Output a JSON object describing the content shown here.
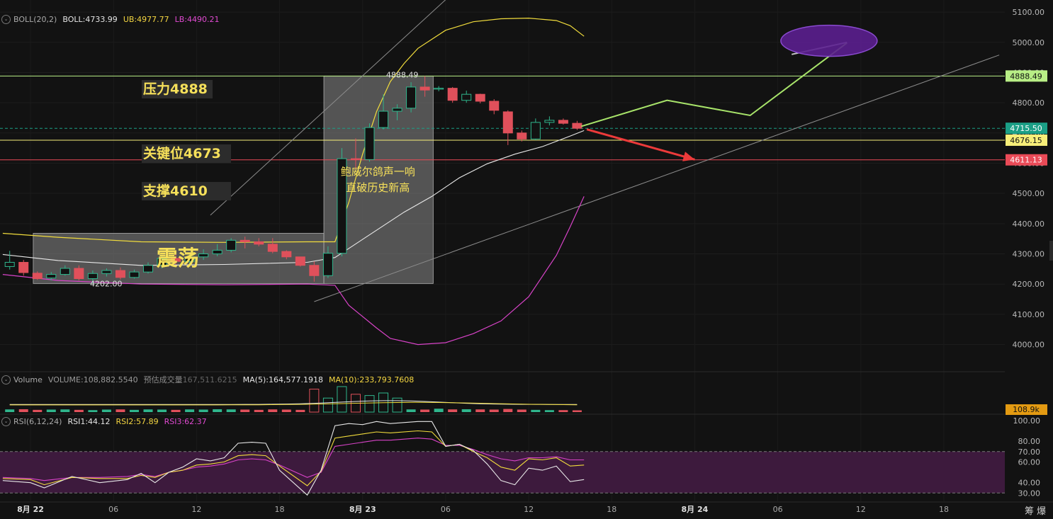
{
  "boll_header": {
    "indicator": "BOLL(20,2)",
    "boll": "BOLL:4733.99",
    "ub": "UB:4977.77",
    "lb": "LB:4490.21"
  },
  "vol_header": {
    "indicator": "Volume",
    "volume": "VOLUME:108,882.5540",
    "est_label": "预估成交量",
    "est_value": "167,511.6215",
    "ma5": "MA(5):164,577.1918",
    "ma10": "MA(10):233,793.7608"
  },
  "rsi_header": {
    "indicator": "RSI(6,12,24)",
    "rsi1": "RSI1:44.12",
    "rsi2": "RSI2:57.89",
    "rsi3": "RSI3:62.37"
  },
  "annotations": {
    "pressure": "压力4888",
    "key_level": "关键位4673",
    "support": "支撑4610",
    "range": "震荡",
    "note_line1": "鲍威尔鸽声一响",
    "note_line2": "直破历史新高",
    "high_label": "4888.49",
    "low_label": "4202.00"
  },
  "corner": "筹 爆",
  "chart_data": [
    {
      "type": "candlestick",
      "title": "",
      "ylim": [
        3910,
        5140
      ],
      "yticks": [
        4000,
        4100,
        4200,
        4300,
        4400,
        4500,
        4600,
        4700,
        4800,
        4900,
        5000,
        5100
      ],
      "ytick_labels": [
        "4000.00",
        "4100.00",
        "4200.00",
        "4300.00",
        "4400.00",
        "4500.00",
        "4600.00",
        "4700.00",
        "4800.00",
        "4900.00",
        "5000.00",
        "5100.00"
      ],
      "xticks": [
        "8月 22",
        "06",
        "12",
        "18",
        "8月 23",
        "06",
        "12",
        "18",
        "8月 24",
        "06",
        "12",
        "18"
      ],
      "xtick_hours": [
        0,
        6,
        12,
        18,
        24,
        30,
        36,
        42,
        48,
        54,
        60,
        66
      ],
      "price_tags": [
        {
          "value": 4888.49,
          "label": "4888.49",
          "color": "#b8ee86",
          "text_color": "#111111"
        },
        {
          "value": 4715.5,
          "label": "4715.50",
          "color": "#1b9f86",
          "text_color": "#ffffff"
        },
        {
          "value": 4676.15,
          "label": "4676.15",
          "color": "#f7ee79",
          "text_color": "#111111"
        },
        {
          "value": 4611.13,
          "label": "4611.13",
          "color": "#ea4a57",
          "text_color": "#ffffff"
        }
      ],
      "horizontal_levels": [
        {
          "value": 4888.49,
          "color": "#b8ee86"
        },
        {
          "value": 4676.15,
          "color": "#f7ee79"
        },
        {
          "value": 4611.13,
          "color": "#ea4a57"
        }
      ],
      "candles": [
        {
          "t": -1.5,
          "o": 4258,
          "h": 4310,
          "l": 4248,
          "c": 4272
        },
        {
          "t": -0.5,
          "o": 4272,
          "h": 4280,
          "l": 4228,
          "c": 4238
        },
        {
          "t": 0.5,
          "o": 4236,
          "h": 4242,
          "l": 4214,
          "c": 4218
        },
        {
          "t": 1.5,
          "o": 4220,
          "h": 4240,
          "l": 4212,
          "c": 4232
        },
        {
          "t": 2.5,
          "o": 4232,
          "h": 4262,
          "l": 4228,
          "c": 4252
        },
        {
          "t": 3.5,
          "o": 4252,
          "h": 4262,
          "l": 4212,
          "c": 4218
        },
        {
          "t": 4.5,
          "o": 4218,
          "h": 4245,
          "l": 4202,
          "c": 4235
        },
        {
          "t": 5.5,
          "o": 4235,
          "h": 4252,
          "l": 4225,
          "c": 4245
        },
        {
          "t": 6.5,
          "o": 4245,
          "h": 4255,
          "l": 4215,
          "c": 4222
        },
        {
          "t": 7.5,
          "o": 4222,
          "h": 4248,
          "l": 4218,
          "c": 4240
        },
        {
          "t": 8.5,
          "o": 4240,
          "h": 4272,
          "l": 4235,
          "c": 4262
        },
        {
          "t": 9.5,
          "o": 4262,
          "h": 4295,
          "l": 4252,
          "c": 4285
        },
        {
          "t": 10.5,
          "o": 4285,
          "h": 4300,
          "l": 4265,
          "c": 4275
        },
        {
          "t": 11.5,
          "o": 4275,
          "h": 4298,
          "l": 4262,
          "c": 4290
        },
        {
          "t": 12.5,
          "o": 4290,
          "h": 4315,
          "l": 4280,
          "c": 4300
        },
        {
          "t": 13.5,
          "o": 4300,
          "h": 4332,
          "l": 4292,
          "c": 4312
        },
        {
          "t": 14.5,
          "o": 4312,
          "h": 4352,
          "l": 4305,
          "c": 4345
        },
        {
          "t": 15.5,
          "o": 4345,
          "h": 4357,
          "l": 4318,
          "c": 4340
        },
        {
          "t": 16.5,
          "o": 4340,
          "h": 4352,
          "l": 4325,
          "c": 4332
        },
        {
          "t": 17.5,
          "o": 4332,
          "h": 4352,
          "l": 4302,
          "c": 4308
        },
        {
          "t": 18.5,
          "o": 4308,
          "h": 4312,
          "l": 4282,
          "c": 4290
        },
        {
          "t": 19.5,
          "o": 4290,
          "h": 4290,
          "l": 4258,
          "c": 4262
        },
        {
          "t": 20.5,
          "o": 4262,
          "h": 4275,
          "l": 4208,
          "c": 4228
        },
        {
          "t": 21.5,
          "o": 4228,
          "h": 4325,
          "l": 4220,
          "c": 4302
        },
        {
          "t": 22.5,
          "o": 4302,
          "h": 4650,
          "l": 4292,
          "c": 4615
        },
        {
          "t": 23.5,
          "o": 4615,
          "h": 4682,
          "l": 4580,
          "c": 4612
        },
        {
          "t": 24.5,
          "o": 4612,
          "h": 4732,
          "l": 4605,
          "c": 4718
        },
        {
          "t": 25.5,
          "o": 4718,
          "h": 4828,
          "l": 4712,
          "c": 4772
        },
        {
          "t": 26.5,
          "o": 4772,
          "h": 4795,
          "l": 4742,
          "c": 4782
        },
        {
          "t": 27.5,
          "o": 4782,
          "h": 4868,
          "l": 4768,
          "c": 4852
        },
        {
          "t": 28.5,
          "o": 4852,
          "h": 4888.49,
          "l": 4820,
          "c": 4842
        },
        {
          "t": 29.5,
          "o": 4845,
          "h": 4855,
          "l": 4838,
          "c": 4848
        },
        {
          "t": 30.5,
          "o": 4848,
          "h": 4852,
          "l": 4800,
          "c": 4808
        },
        {
          "t": 31.5,
          "o": 4808,
          "h": 4840,
          "l": 4800,
          "c": 4828
        },
        {
          "t": 32.5,
          "o": 4828,
          "h": 4830,
          "l": 4798,
          "c": 4805
        },
        {
          "t": 33.5,
          "o": 4805,
          "h": 4812,
          "l": 4762,
          "c": 4775
        },
        {
          "t": 34.5,
          "o": 4770,
          "h": 4775,
          "l": 4660,
          "c": 4700
        },
        {
          "t": 35.5,
          "o": 4700,
          "h": 4708,
          "l": 4672,
          "c": 4680
        },
        {
          "t": 36.5,
          "o": 4680,
          "h": 4748,
          "l": 4676,
          "c": 4735
        },
        {
          "t": 37.5,
          "o": 4735,
          "h": 4755,
          "l": 4725,
          "c": 4742
        },
        {
          "t": 38.5,
          "o": 4742,
          "h": 4748,
          "l": 4728,
          "c": 4732
        },
        {
          "t": 39.5,
          "o": 4732,
          "h": 4740,
          "l": 4710,
          "c": 4715.5
        }
      ],
      "bands": {
        "upper": [
          [
            -2,
            4368
          ],
          [
            2,
            4355
          ],
          [
            8,
            4340
          ],
          [
            14,
            4338
          ],
          [
            20,
            4340
          ],
          [
            22,
            4340
          ],
          [
            23,
            4470
          ],
          [
            24,
            4630
          ],
          [
            25,
            4770
          ],
          [
            26,
            4870
          ],
          [
            27,
            4930
          ],
          [
            28,
            4980
          ],
          [
            30,
            5040
          ],
          [
            32,
            5068
          ],
          [
            34,
            5078
          ],
          [
            36,
            5080
          ],
          [
            38,
            5072
          ],
          [
            39,
            5055
          ],
          [
            40,
            5020
          ]
        ],
        "middle": [
          [
            -2,
            4298
          ],
          [
            2,
            4278
          ],
          [
            8,
            4262
          ],
          [
            14,
            4265
          ],
          [
            20,
            4272
          ],
          [
            22,
            4288
          ],
          [
            23,
            4318
          ],
          [
            25,
            4378
          ],
          [
            27,
            4438
          ],
          [
            29,
            4490
          ],
          [
            31,
            4552
          ],
          [
            33,
            4598
          ],
          [
            35,
            4630
          ],
          [
            37,
            4655
          ],
          [
            39,
            4690
          ],
          [
            40,
            4708
          ]
        ],
        "lower": [
          [
            -2,
            4232
          ],
          [
            2,
            4212
          ],
          [
            8,
            4200
          ],
          [
            14,
            4198
          ],
          [
            20,
            4200
          ],
          [
            22,
            4196
          ],
          [
            23,
            4130
          ],
          [
            25,
            4055
          ],
          [
            26,
            4020
          ],
          [
            28,
            4000
          ],
          [
            30,
            4006
          ],
          [
            32,
            4036
          ],
          [
            34,
            4078
          ],
          [
            36,
            4158
          ],
          [
            38,
            4295
          ],
          [
            39,
            4390
          ],
          [
            40,
            4490
          ]
        ]
      },
      "volume": [
        0.3,
        0.32,
        0.25,
        0.28,
        0.3,
        0.25,
        0.22,
        0.28,
        0.3,
        0.25,
        0.3,
        0.28,
        0.25,
        0.3,
        0.28,
        0.32,
        0.3,
        0.28,
        0.25,
        0.3,
        0.28,
        0.25,
        0.9,
        0.55,
        1.0,
        0.7,
        0.65,
        0.75,
        0.55,
        0.3,
        0.28,
        0.38,
        0.3,
        0.32,
        0.3,
        0.28,
        0.35,
        0.28,
        0.25,
        0.22,
        0.22,
        0.2
      ],
      "volume_tag": "108.9k",
      "rsi_ylim": [
        22,
        104
      ],
      "rsi_ticks": [
        100,
        80,
        70,
        60,
        40,
        30
      ],
      "rsi_tick_labels": [
        "100.00",
        "80.00",
        "70.00",
        "60.00",
        "40.00",
        "30.00"
      ],
      "rsi_band": [
        30,
        70
      ],
      "rsi": {
        "rsi1": [
          [
            -2,
            42
          ],
          [
            0,
            40
          ],
          [
            1,
            35
          ],
          [
            3,
            46
          ],
          [
            5,
            40
          ],
          [
            7,
            43
          ],
          [
            8,
            49
          ],
          [
            9,
            40
          ],
          [
            10,
            50
          ],
          [
            11,
            55
          ],
          [
            12,
            63
          ],
          [
            13,
            61
          ],
          [
            14,
            64
          ],
          [
            15,
            78
          ],
          [
            16,
            79
          ],
          [
            17,
            78
          ],
          [
            18,
            52
          ],
          [
            20,
            28
          ],
          [
            21,
            52
          ],
          [
            22,
            95
          ],
          [
            23,
            97
          ],
          [
            24,
            96
          ],
          [
            25,
            99
          ],
          [
            26,
            97
          ],
          [
            28,
            99
          ],
          [
            29,
            99
          ],
          [
            30,
            75
          ],
          [
            31,
            77
          ],
          [
            32,
            71
          ],
          [
            33,
            58
          ],
          [
            34,
            42
          ],
          [
            35,
            38
          ],
          [
            36,
            54
          ],
          [
            37,
            52
          ],
          [
            38,
            56
          ],
          [
            39,
            41
          ],
          [
            40,
            43
          ]
        ],
        "rsi2": [
          [
            -2,
            44
          ],
          [
            0,
            43
          ],
          [
            1,
            38
          ],
          [
            3,
            45
          ],
          [
            5,
            44
          ],
          [
            7,
            44
          ],
          [
            8,
            47
          ],
          [
            9,
            45
          ],
          [
            10,
            50
          ],
          [
            11,
            52
          ],
          [
            12,
            57
          ],
          [
            13,
            58
          ],
          [
            14,
            60
          ],
          [
            15,
            66
          ],
          [
            16,
            67
          ],
          [
            17,
            66
          ],
          [
            18,
            56
          ],
          [
            20,
            37
          ],
          [
            21,
            51
          ],
          [
            22,
            83
          ],
          [
            23,
            85
          ],
          [
            24,
            87
          ],
          [
            25,
            89
          ],
          [
            26,
            88
          ],
          [
            28,
            90
          ],
          [
            29,
            89
          ],
          [
            30,
            75
          ],
          [
            31,
            77
          ],
          [
            32,
            70
          ],
          [
            33,
            64
          ],
          [
            34,
            55
          ],
          [
            35,
            52
          ],
          [
            36,
            63
          ],
          [
            37,
            62
          ],
          [
            38,
            64
          ],
          [
            39,
            56
          ],
          [
            40,
            57
          ]
        ],
        "rsi3": [
          [
            -2,
            45
          ],
          [
            0,
            44
          ],
          [
            1,
            42
          ],
          [
            3,
            45
          ],
          [
            5,
            45
          ],
          [
            7,
            46
          ],
          [
            8,
            48
          ],
          [
            9,
            46
          ],
          [
            10,
            50
          ],
          [
            11,
            52
          ],
          [
            12,
            55
          ],
          [
            13,
            56
          ],
          [
            14,
            58
          ],
          [
            15,
            62
          ],
          [
            16,
            63
          ],
          [
            17,
            62
          ],
          [
            18,
            57
          ],
          [
            20,
            45
          ],
          [
            21,
            50
          ],
          [
            22,
            75
          ],
          [
            23,
            77
          ],
          [
            24,
            79
          ],
          [
            25,
            81
          ],
          [
            26,
            81
          ],
          [
            28,
            83
          ],
          [
            29,
            82
          ],
          [
            30,
            76
          ],
          [
            31,
            76
          ],
          [
            32,
            72
          ],
          [
            33,
            67
          ],
          [
            34,
            63
          ],
          [
            35,
            61
          ],
          [
            36,
            64
          ],
          [
            37,
            64
          ],
          [
            38,
            65
          ],
          [
            39,
            62
          ],
          [
            40,
            62
          ]
        ]
      },
      "drawings": {
        "projection": [
          [
            39.8,
            4722
          ],
          [
            46,
            4808
          ],
          [
            52,
            4758
          ],
          [
            59,
            4998
          ]
        ],
        "down_arrow": [
          [
            40.2,
            4712
          ],
          [
            48,
            4612
          ]
        ],
        "channel_upper": [
          [
            13,
            4428
          ],
          [
            30.5,
            5162
          ]
        ],
        "channel_lower": [
          [
            20.5,
            4142
          ],
          [
            70,
            4958
          ]
        ],
        "target_line": [
          [
            55,
            4960
          ],
          [
            59,
            5000
          ]
        ],
        "target_ellipse": {
          "t": 57.7,
          "value": 5005
        }
      }
    }
  ]
}
